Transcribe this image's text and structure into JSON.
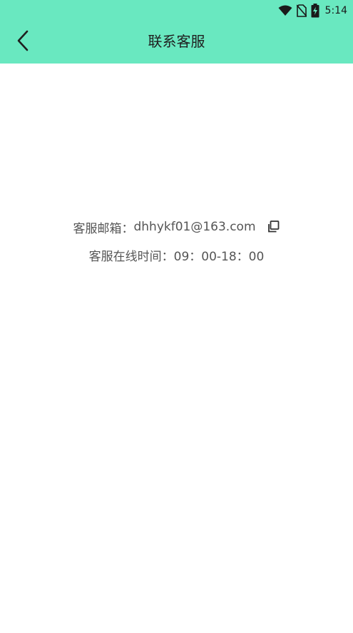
{
  "status_bar": {
    "time": "5:14",
    "icons": [
      "wifi-icon",
      "no-sim-icon",
      "battery-charging-icon"
    ]
  },
  "toolbar": {
    "back_icon": "chevron-left-icon",
    "title": "联系客服"
  },
  "contact": {
    "email_label": "客服邮箱：",
    "email": "dhhykf01@163.com",
    "copy_icon": "copy-icon",
    "hours_label": "客服在线时间：",
    "hours": "09：00-18：00"
  },
  "colors": {
    "header_bg": "#69e8c0",
    "text_primary": "#1f1f1f",
    "text_secondary": "#555555"
  }
}
